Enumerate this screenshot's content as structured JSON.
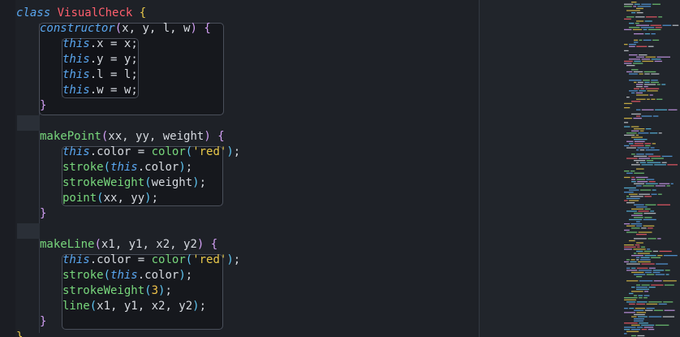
{
  "code": {
    "class_keyword": "class",
    "class_name": "VisualCheck",
    "open_brace": "{",
    "close_brace": "}",
    "constructor": {
      "name": "constructor",
      "params": "x, y, l, w",
      "body": [
        {
          "prop": "x",
          "value": "x"
        },
        {
          "prop": "y",
          "value": "y"
        },
        {
          "prop": "l",
          "value": "l"
        },
        {
          "prop": "w",
          "value": "w"
        }
      ]
    },
    "make_point": {
      "name": "makePoint",
      "params": "xx, yy, weight",
      "color_fn": "color",
      "color_arg": "'red'",
      "stroke_fn": "stroke",
      "stroke_weight_fn": "strokeWeight",
      "stroke_weight_arg": "weight",
      "draw_fn": "point",
      "draw_args": "xx, yy"
    },
    "make_line": {
      "name": "makeLine",
      "params": "x1, y1, x2, y2",
      "color_fn": "color",
      "color_arg": "'red'",
      "stroke_fn": "stroke",
      "stroke_weight_fn": "strokeWeight",
      "stroke_weight_arg": "3",
      "draw_fn": "line",
      "draw_args": "x1, y1, x2, y2"
    },
    "this_keyword": "this",
    "color_prop": "color"
  },
  "colors": {
    "editor_bg": "#1e2127",
    "minimap_bg": "#21252b",
    "keyword": "#5aa7f0",
    "class_name": "#ff5f6d",
    "function": "#78d77c",
    "string": "#e8c84a"
  }
}
